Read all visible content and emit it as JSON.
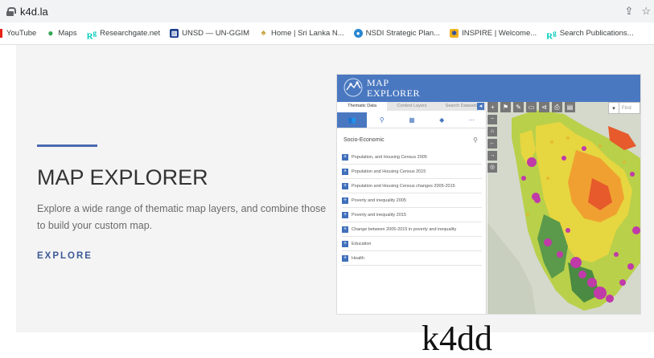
{
  "browser": {
    "url": "k4d.la",
    "bookmarks": [
      {
        "label": "YouTube",
        "icon": "youtube-icon"
      },
      {
        "label": "Maps",
        "icon": "maps-icon"
      },
      {
        "label": "Researchgate.net",
        "icon": "researchgate-icon"
      },
      {
        "label": "UNSD — UN-GGIM",
        "icon": "unsd-icon"
      },
      {
        "label": "Home | Sri Lanka N...",
        "icon": "home-icon"
      },
      {
        "label": "NSDI Strategic Plan...",
        "icon": "nsdi-icon"
      },
      {
        "label": "INSPIRE | Welcome...",
        "icon": "inspire-icon"
      },
      {
        "label": "Search Publications...",
        "icon": "researchgate-icon"
      }
    ]
  },
  "hero": {
    "title": "MAP EXPLORER",
    "description": "Explore a wide range of thematic map layers, and combine those to build your custom map.",
    "cta": "EXPLORE",
    "accent_color": "#4a6bb0"
  },
  "map_app": {
    "title_line1": "MAP",
    "title_line2": "EXPLORER",
    "tabs": [
      "Thematic Data",
      "Context Layers",
      "Search Datasets"
    ],
    "section": "Socio-Economic",
    "layers": [
      "Population, and Housing Census 2005",
      "Population and Housing Census 2015",
      "Population and Housing Census changes 2005-2015",
      "Poverty and inequality 2005",
      "Poverty and inequality 2015",
      "Change between 2005-2015 in poverty and inequality",
      "Education",
      "Health"
    ],
    "find_placeholder": "Find",
    "header_color": "#4a78c0"
  },
  "bottom_text": "k4dd"
}
